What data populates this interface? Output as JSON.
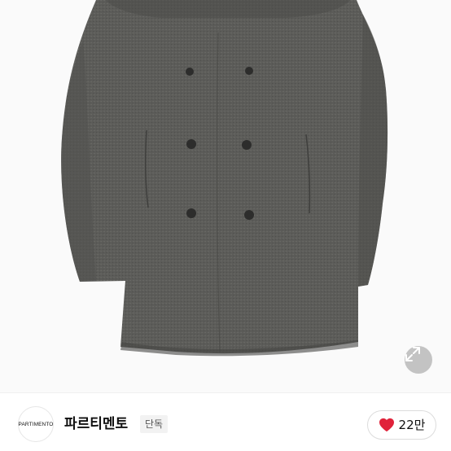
{
  "product": {
    "image_alt": "",
    "expand_icon": "expand-icon"
  },
  "brand": {
    "logo_text": "PARTIMENTO",
    "name": "파르티멘토",
    "badge": "단독"
  },
  "likes": {
    "icon": "heart-icon",
    "count": "22만",
    "heart_color": "#e0223a"
  },
  "colors": {
    "coat": "#5b5b58",
    "background": "#fafafa"
  }
}
